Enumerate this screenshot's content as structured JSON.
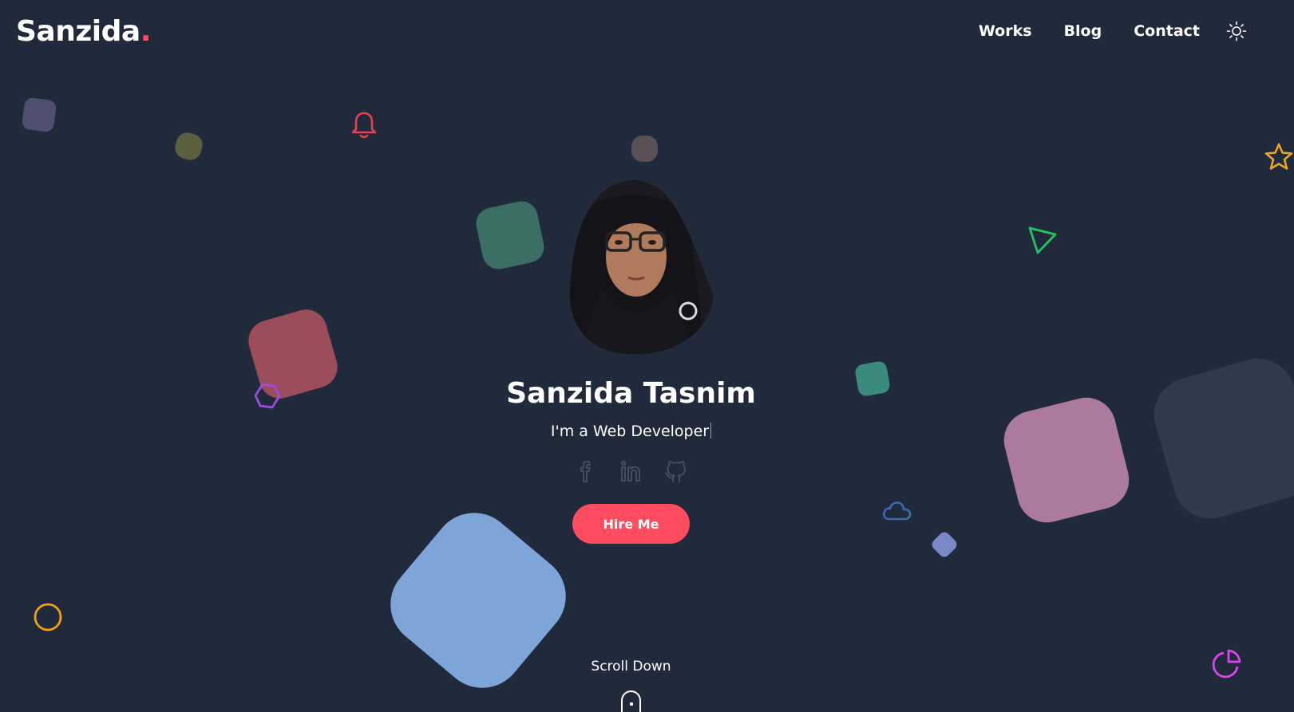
{
  "header": {
    "logo_text": "Sanzida",
    "logo_dot": ".",
    "nav": [
      {
        "label": "Works"
      },
      {
        "label": "Blog"
      },
      {
        "label": "Contact"
      }
    ],
    "theme_toggle_icon": "sun-icon"
  },
  "hero": {
    "avatar_icon": "profile-photo",
    "name": "Sanzida Tasnim",
    "role": "I'm a Web Developer",
    "socials": [
      {
        "icon": "facebook-icon"
      },
      {
        "icon": "linkedin-icon"
      },
      {
        "icon": "github-icon"
      }
    ],
    "cta_label": "Hire Me",
    "scroll_label": "Scroll Down"
  },
  "colors": {
    "background": "#212a3a",
    "accent": "#ff4c60",
    "text": "#ffffff",
    "social_icon": "#454e5f"
  },
  "decorations": [
    "bell-icon",
    "star-icon",
    "triangle-icon",
    "hexagon-icon",
    "cloud-icon",
    "circle-icon",
    "pie-chart-icon"
  ]
}
